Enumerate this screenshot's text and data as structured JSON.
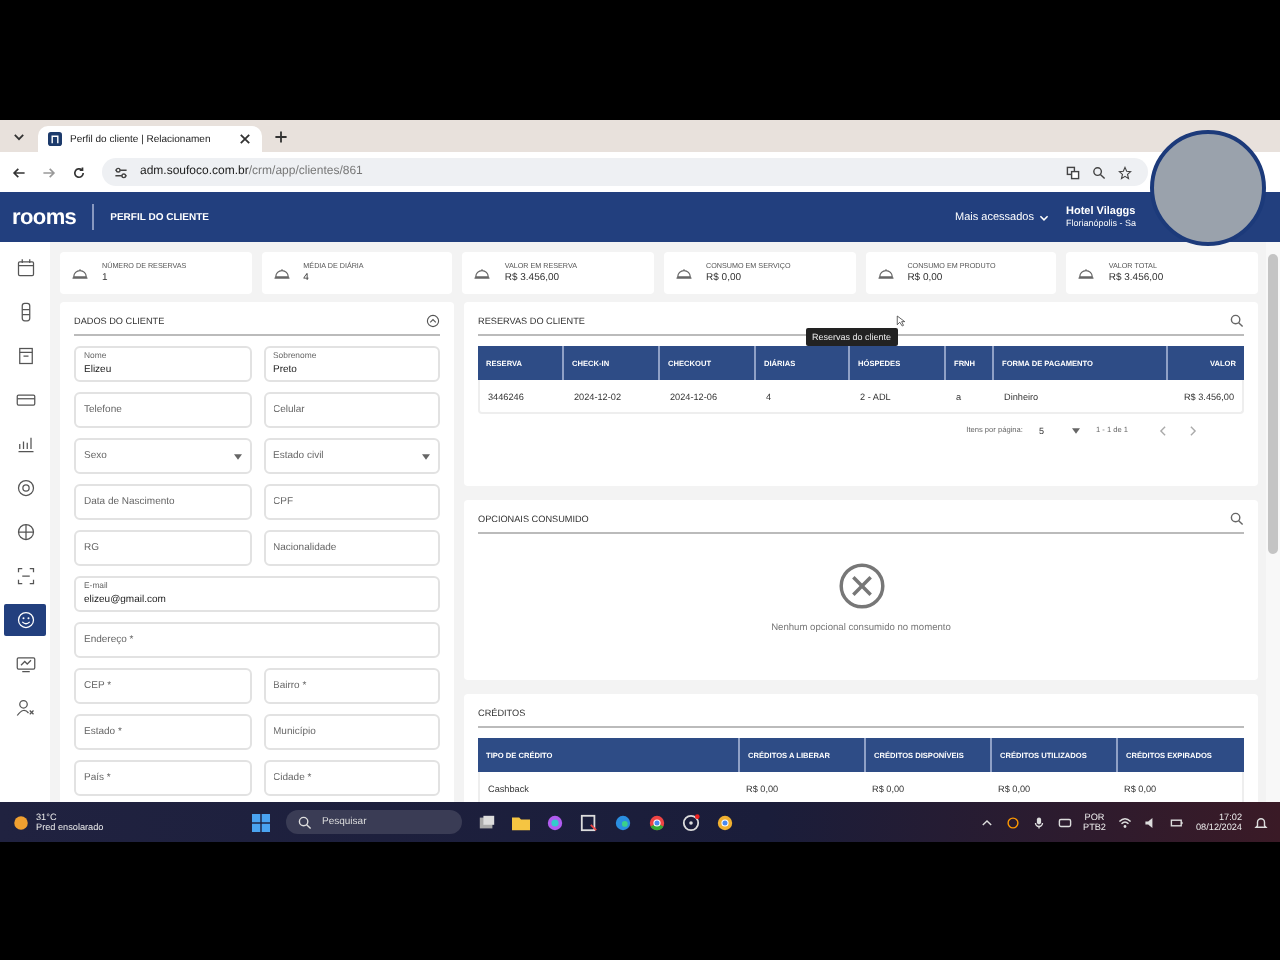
{
  "browser": {
    "tab_title": "Perfil do cliente | Relacionamen",
    "url_host": "adm.soufoco.com.br",
    "url_path": "/crm/app/clientes/861"
  },
  "header": {
    "logo": "rooms",
    "page_title": "PERFIL DO CLIENTE",
    "menu": "Mais acessados",
    "hotel_name": "Hotel Vilaggs",
    "hotel_city": "Florianópolis - Sa"
  },
  "sidebar": {
    "items": [
      {
        "selected": false
      },
      {
        "selected": false
      },
      {
        "selected": false
      },
      {
        "selected": false
      },
      {
        "selected": false
      },
      {
        "selected": false
      },
      {
        "selected": false
      },
      {
        "selected": false
      },
      {
        "selected": true
      },
      {
        "selected": false
      },
      {
        "selected": false
      }
    ]
  },
  "stats": [
    {
      "label": "NÚMERO DE RESERVAS",
      "value": "1"
    },
    {
      "label": "MÉDIA DE DIÁRIA",
      "value": "4"
    },
    {
      "label": "VALOR EM RESERVA",
      "value": "R$ 3.456,00"
    },
    {
      "label": "CONSUMO EM SERVIÇO",
      "value": "R$ 0,00"
    },
    {
      "label": "CONSUMO EM PRODUTO",
      "value": "R$ 0,00"
    },
    {
      "label": "VALOR TOTAL",
      "value": "R$ 3.456,00"
    }
  ],
  "client": {
    "title": "DADOS DO CLIENTE",
    "fields": [
      {
        "kind": "text",
        "label": "Nome",
        "value": "Elizeu"
      },
      {
        "kind": "text",
        "label": "Sobrenome",
        "value": "Preto"
      },
      {
        "kind": "empty",
        "placeholder": "Telefone"
      },
      {
        "kind": "empty",
        "placeholder": "Celular"
      },
      {
        "kind": "select",
        "placeholder": "Sexo"
      },
      {
        "kind": "select",
        "placeholder": "Estado civil"
      },
      {
        "kind": "empty",
        "placeholder": "Data de Nascimento"
      },
      {
        "kind": "empty",
        "placeholder": "CPF"
      },
      {
        "kind": "empty",
        "placeholder": "RG"
      },
      {
        "kind": "empty",
        "placeholder": "Nacionalidade"
      },
      {
        "kind": "wide",
        "label": "E-mail",
        "value": "elizeu@gmail.com"
      },
      {
        "kind": "wideempty",
        "placeholder": "Endereço *"
      },
      {
        "kind": "empty",
        "placeholder": "CEP *"
      },
      {
        "kind": "empty",
        "placeholder": "Bairro *"
      },
      {
        "kind": "empty",
        "placeholder": "Estado *"
      },
      {
        "kind": "empty",
        "placeholder": "Município"
      },
      {
        "kind": "empty",
        "placeholder": "País *"
      },
      {
        "kind": "empty",
        "placeholder": "Cidade *"
      }
    ]
  },
  "reservations": {
    "title": "RESERVAS DO CLIENTE",
    "tooltip": "Reservas do cliente",
    "columns": [
      "RESERVA",
      "CHECK-IN",
      "CHECKOUT",
      "DIÁRIAS",
      "HÓSPEDES",
      "FRNH",
      "FORMA DE PAGAMENTO",
      "VALOR"
    ],
    "rows": [
      [
        "3446246",
        "2024-12-02",
        "2024-12-06",
        "4",
        "2 - ADL",
        "a",
        "Dinheiro",
        "R$ 3.456,00"
      ]
    ],
    "page_size_label": "Itens por página:",
    "page_size": "5",
    "range": "1 - 1 de 1"
  },
  "optionals": {
    "title": "OPCIONAIS CONSUMIDO",
    "empty_message": "Nenhum opcional consumido no momento"
  },
  "credits": {
    "title": "CRÉDITOS",
    "columns": [
      "TIPO DE CRÉDITO",
      "CRÉDITOS A LIBERAR",
      "CRÉDITOS DISPONÍVEIS",
      "CRÉDITOS UTILIZADOS",
      "CRÉDITOS EXPIRADOS"
    ],
    "rows": [
      [
        "Cashback",
        "R$ 0,00",
        "R$ 0,00",
        "R$ 0,00",
        "R$ 0,00"
      ]
    ]
  },
  "taskbar": {
    "temperature": "31°C",
    "weather": "Pred ensolarado",
    "search_placeholder": "Pesquisar",
    "language": "POR",
    "layout": "PTB2",
    "time": "17:02",
    "date": "08/12/2024"
  }
}
